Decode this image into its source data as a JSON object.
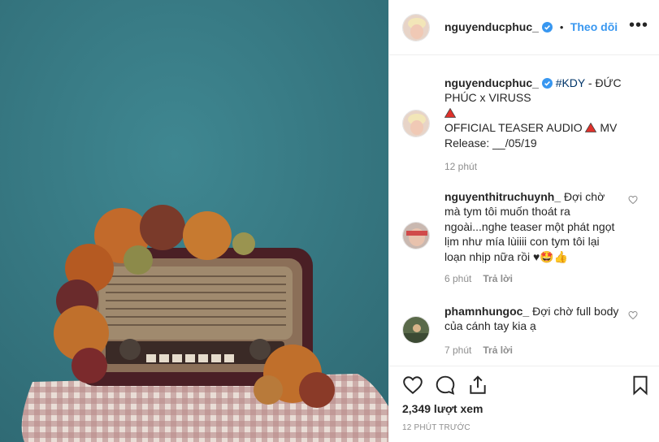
{
  "post": {
    "username": "nguyenducphuc_",
    "follow_label": "Theo dõi",
    "dot": "•",
    "more": "•••"
  },
  "caption": {
    "username": "nguyenducphuc_",
    "hashtag": "#KDY",
    "line1_rest": " - ĐỨC",
    "line2": "PHÚC x VIRUSS",
    "line4": "OFFICIAL TEASER AUDIO ",
    "line4_end": " MV",
    "line5": "Release: __/05/19",
    "time": "12 phút"
  },
  "comments": [
    {
      "username": "nguyenthitruchuynh_",
      "text": " Đợi chờ mà tym tôi muốn thoát ra ngoài...nghe teaser một phát ngọt lịm như mía lùiiii con tym tôi lại loạn nhịp nữa rồi ♥🤩👍",
      "time": "6 phút",
      "reply": "Trả lời"
    },
    {
      "username": "phamnhungoc_",
      "text": " Đợi chờ full body của cánh tay kia ạ",
      "time": "7 phút",
      "reply": "Trả lời"
    }
  ],
  "stats": {
    "views": "2,349 lượt xem",
    "timestamp": "12 PHÚT TRƯỚC"
  },
  "colors": {
    "follow": "#3897f0",
    "verified": "#3897f0",
    "muted": "#8e8e8e",
    "media_bg": "#3b7e87"
  }
}
